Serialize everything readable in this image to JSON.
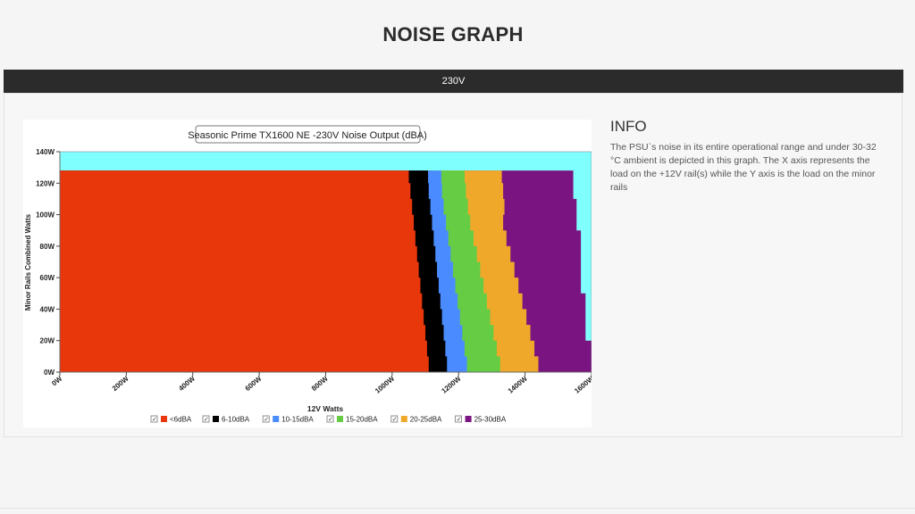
{
  "page": {
    "title": "NOISE GRAPH",
    "tab_label": "230V"
  },
  "info": {
    "heading": "INFO",
    "text": "The PSU`s noise in its entire operational range and under 30-32 °C ambient is depicted in this graph. The X axis represents the load on the +12V rail(s) while the Y axis is the load on the minor rails"
  },
  "colors": {
    "background": "#00ffff",
    "under6": "#e8370a",
    "6_10": "#000000",
    "10_15": "#4a8cff",
    "15_20": "#66cc44",
    "20_25": "#f0a82a",
    "25_30": "#7a1480"
  },
  "chart_data": {
    "type": "area",
    "title": "Seasonic Prime TX1600 NE -230V Noise Output (dBA)",
    "xlabel": "12V Watts",
    "ylabel": "Minor Rails Combined Watts",
    "xlim": [
      0,
      1600
    ],
    "ylim": [
      0,
      140
    ],
    "x_ticks": [
      "0W",
      "200W",
      "400W",
      "600W",
      "800W",
      "1000W",
      "1200W",
      "1400W",
      "1600W"
    ],
    "y_ticks": [
      "0W",
      "20W",
      "40W",
      "60W",
      "80W",
      "100W",
      "120W",
      "140W"
    ],
    "grid": false,
    "legend_position": "bottom",
    "background_color": "#80ffff",
    "y_levels": [
      0,
      10,
      20,
      30,
      40,
      50,
      60,
      70,
      80,
      90,
      100,
      110,
      120,
      128
    ],
    "series": [
      {
        "name": "<6dBA",
        "color": "#e8370a",
        "boundary_x": [
          1110,
          1105,
          1100,
          1095,
          1090,
          1085,
          1080,
          1075,
          1070,
          1065,
          1060,
          1055,
          1050,
          1050
        ]
      },
      {
        "name": "6-10dBA",
        "color": "#000000",
        "boundary_x": [
          1165,
          1160,
          1155,
          1150,
          1145,
          1140,
          1135,
          1130,
          1125,
          1120,
          1115,
          1110,
          1108,
          1108
        ]
      },
      {
        "name": "10-15dBA",
        "color": "#4a8cff",
        "boundary_x": [
          1225,
          1218,
          1211,
          1204,
          1197,
          1190,
          1183,
          1176,
          1169,
          1162,
          1155,
          1150,
          1148,
          1148
        ]
      },
      {
        "name": "15-20dBA",
        "color": "#66cc44",
        "boundary_x": [
          1325,
          1315,
          1305,
          1295,
          1285,
          1275,
          1265,
          1255,
          1245,
          1235,
          1228,
          1222,
          1218,
          1218
        ]
      },
      {
        "name": "20-25dBA",
        "color": "#f0a82a",
        "boundary_x": [
          1440,
          1428,
          1416,
          1404,
          1392,
          1380,
          1368,
          1356,
          1344,
          1334,
          1338,
          1334,
          1330,
          1330
        ]
      },
      {
        "name": "25-30dBA",
        "color": "#7a1480",
        "boundary_x": [
          1600,
          1600,
          1582,
          1582,
          1582,
          1568,
          1568,
          1568,
          1568,
          1555,
          1555,
          1545,
          1545,
          1545
        ]
      }
    ]
  }
}
